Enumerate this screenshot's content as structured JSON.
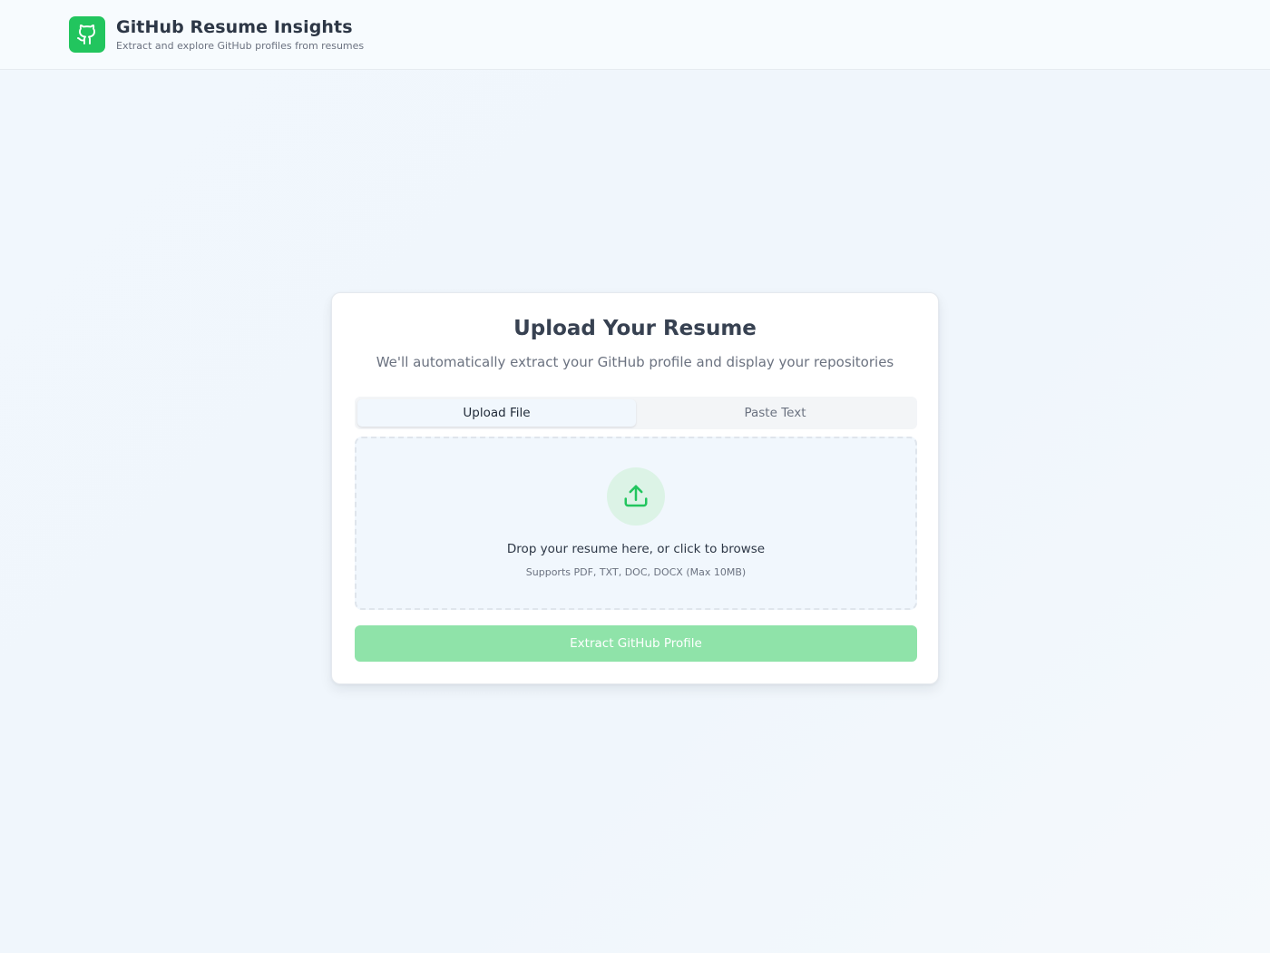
{
  "header": {
    "title": "GitHub Resume Insights",
    "subtitle": "Extract and explore GitHub profiles from resumes",
    "logo_icon": "github-icon"
  },
  "card": {
    "title": "Upload Your Resume",
    "subtitle": "We'll automatically extract your GitHub profile and display your repositories",
    "tabs": [
      {
        "label": "Upload File",
        "active": true
      },
      {
        "label": "Paste Text",
        "active": false
      }
    ],
    "dropzone": {
      "icon": "upload-icon",
      "main_text": "Drop your resume here, or click to browse",
      "hint_text": "Supports PDF, TXT, DOC, DOCX (Max 10MB)"
    },
    "extract_button": {
      "label": "Extract GitHub Profile",
      "disabled": true
    }
  },
  "colors": {
    "accent": "#22c55e",
    "accent_light": "#dcf3e6",
    "button_disabled": "#8fe3a9"
  }
}
